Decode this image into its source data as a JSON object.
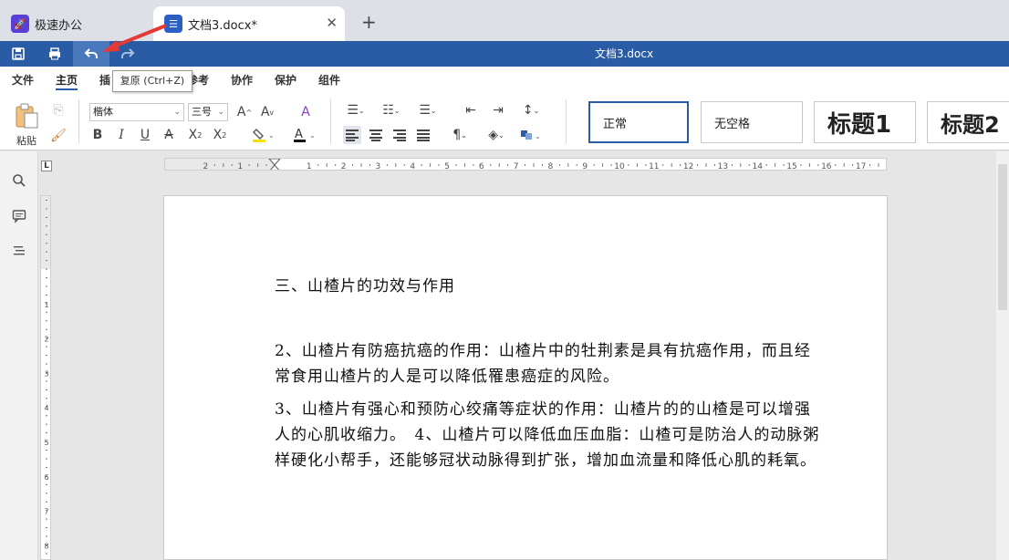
{
  "tabs": [
    {
      "label": "极速办公",
      "icon": "rocket-icon"
    },
    {
      "label": "文档3.docx*",
      "icon": "document-icon"
    }
  ],
  "window": {
    "title": "文档3.docx"
  },
  "menu": [
    "文件",
    "主页",
    "插入",
    "参考",
    "协作",
    "保护",
    "组件"
  ],
  "menu_visible": {
    "file": "文件",
    "home": "主页",
    "insert_partial": "插",
    "ref_partial": "参考",
    "collab": "协作",
    "protect": "保护",
    "plugins": "组件"
  },
  "tooltip": "复原 (Ctrl+Z)",
  "ribbon": {
    "paste_label": "粘贴",
    "font_name": "楷体",
    "font_size": "三号",
    "styles": [
      "正常",
      "无空格",
      "标题1",
      "标题2"
    ]
  },
  "document": {
    "heading": "三、山楂片的功效与作用",
    "paragraphs": [
      "2、山楂片有防癌抗癌的作用：山楂片中的牡荆素是具有抗癌作用，而且经常食用山楂片的人是可以降低罹患癌症的风险。",
      "3、山楂片有强心和预防心绞痛等症状的作用：山楂片的的山楂是可以增强人的心肌收缩力。　4、山楂片可以降低血压血脂：山楂可是防治人的动脉粥样硬化小帮手，还能够冠状动脉得到扩张，增加血流量和降低心肌的耗氧。"
    ]
  },
  "ruler_numbers": [
    "2",
    "1",
    "1",
    "2",
    "3",
    "4",
    "5",
    "6",
    "7",
    "8",
    "9",
    "10",
    "11",
    "12",
    "13",
    "14",
    "15",
    "16",
    "17"
  ],
  "colors": {
    "accent": "#2a5ba5",
    "annotation": "#e53935"
  }
}
